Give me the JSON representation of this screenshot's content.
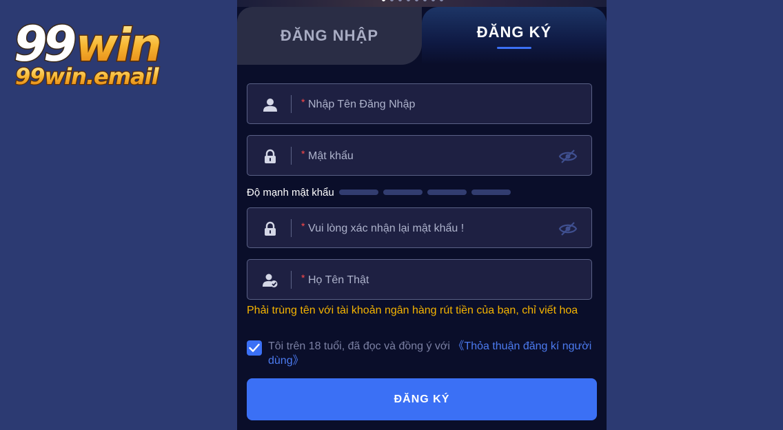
{
  "brand": {
    "logo_text": "99win",
    "domain": "99win.email"
  },
  "tabs": {
    "login_label": "ĐĂNG NHẬP",
    "register_label": "ĐĂNG KÝ",
    "active": "register"
  },
  "form": {
    "required_mark": "*",
    "fields": [
      {
        "placeholder": "Nhập Tên Đăng Nhập",
        "value": "",
        "icon": "user-icon"
      },
      {
        "placeholder": "Mật khẩu",
        "value": "",
        "icon": "lock-icon",
        "toggle_icon": "eye-off-icon"
      },
      {
        "placeholder": "Vui lòng xác nhận lại mật khẩu !",
        "value": "",
        "icon": "lock-icon",
        "toggle_icon": "eye-off-icon"
      },
      {
        "placeholder": "Họ Tên Thật",
        "value": "",
        "icon": "user-check-icon"
      }
    ],
    "strength_label": "Độ mạnh mật khẩu",
    "strength_level": 0,
    "hint": "Phải trùng tên với tài khoản ngân hàng rút tiền của bạn, chỉ viết hoa",
    "agree_checked": true,
    "agree_text": "Tôi trên 18 tuổi, đã đọc và đồng ý với ",
    "agree_link": "《Thỏa thuận đăng kí người dùng》",
    "submit_label": "ĐĂNG KÝ"
  },
  "colors": {
    "page_bg": "#2c3a72",
    "panel_bg": "#0a0e2a",
    "accent": "#3b70f5",
    "hint": "#f5b400",
    "required": "#ff4a4a"
  }
}
